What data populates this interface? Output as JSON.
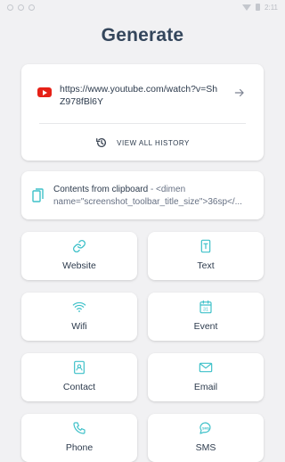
{
  "status_bar": {
    "time": "2:11"
  },
  "page": {
    "title": "Generate"
  },
  "history": {
    "url": "https://www.youtube.com/watch?v=ShZ978fBl6Y",
    "view_all_label": "VIEW ALL HISTORY"
  },
  "clipboard": {
    "label": "Contents from clipboard",
    "content": " - <dimen name=\"screenshot_toolbar_title_size\">36sp</..."
  },
  "tiles": [
    {
      "label": "Website",
      "icon": "link-icon"
    },
    {
      "label": "Text",
      "icon": "text-document-icon"
    },
    {
      "label": "Wifi",
      "icon": "wifi-icon"
    },
    {
      "label": "Event",
      "icon": "calendar-icon"
    },
    {
      "label": "Contact",
      "icon": "contact-card-icon"
    },
    {
      "label": "Email",
      "icon": "envelope-icon"
    },
    {
      "label": "Phone",
      "icon": "phone-icon"
    },
    {
      "label": "SMS",
      "icon": "sms-icon"
    }
  ],
  "colors": {
    "accent": "#3fc1c9",
    "youtube": "#e62117",
    "background": "#f1f1f3",
    "title": "#34465c"
  }
}
